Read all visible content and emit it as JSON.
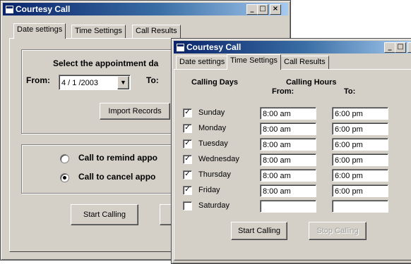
{
  "back_window": {
    "title": "Courtesy Call",
    "title_buttons": [
      "_",
      "□",
      "×"
    ],
    "tabs": [
      {
        "label": "Date settings"
      },
      {
        "label": "Time Settings"
      },
      {
        "label": "Call Results"
      }
    ],
    "date_group": {
      "heading": "Select the appointment da",
      "from_label": "From:",
      "from_value": "4 / 1 /2003",
      "to_label": "To:",
      "import_button": "Import Records"
    },
    "mode_group": {
      "option_remind": "Call to remind appo",
      "option_cancel": "Call to cancel appo",
      "selected": "cancel"
    },
    "start_button": "Start Calling"
  },
  "front_window": {
    "title": "Courtesy Call",
    "title_buttons": [
      "_",
      "□",
      "×"
    ],
    "tabs": [
      {
        "label": "Date settings"
      },
      {
        "label": "Time Settings"
      },
      {
        "label": "Call Results"
      }
    ],
    "active_tab": "Time Settings",
    "headers": {
      "calling_days": "Calling Days",
      "calling_hours": "Calling Hours",
      "from": "From:",
      "to": "To:"
    },
    "days": [
      {
        "name": "Sunday",
        "checked": true,
        "from": "8:00 am",
        "to": "6:00 pm"
      },
      {
        "name": "Monday",
        "checked": true,
        "from": "8:00 am",
        "to": "6:00 pm"
      },
      {
        "name": "Tuesday",
        "checked": true,
        "from": "8:00 am",
        "to": "6:00 pm"
      },
      {
        "name": "Wednesday",
        "checked": true,
        "from": "8:00 am",
        "to": "6:00 pm"
      },
      {
        "name": "Thursday",
        "checked": true,
        "from": "8:00 am",
        "to": "6:00 pm"
      },
      {
        "name": "Friday",
        "checked": true,
        "from": "8:00 am",
        "to": "6:00 pm"
      },
      {
        "name": "Saturday",
        "checked": false,
        "from": "",
        "to": ""
      }
    ],
    "start_button": "Start Calling",
    "stop_button": "Stop Calling"
  },
  "colors": {
    "titlebar": "#0a246a",
    "face": "#d4d0c8"
  }
}
